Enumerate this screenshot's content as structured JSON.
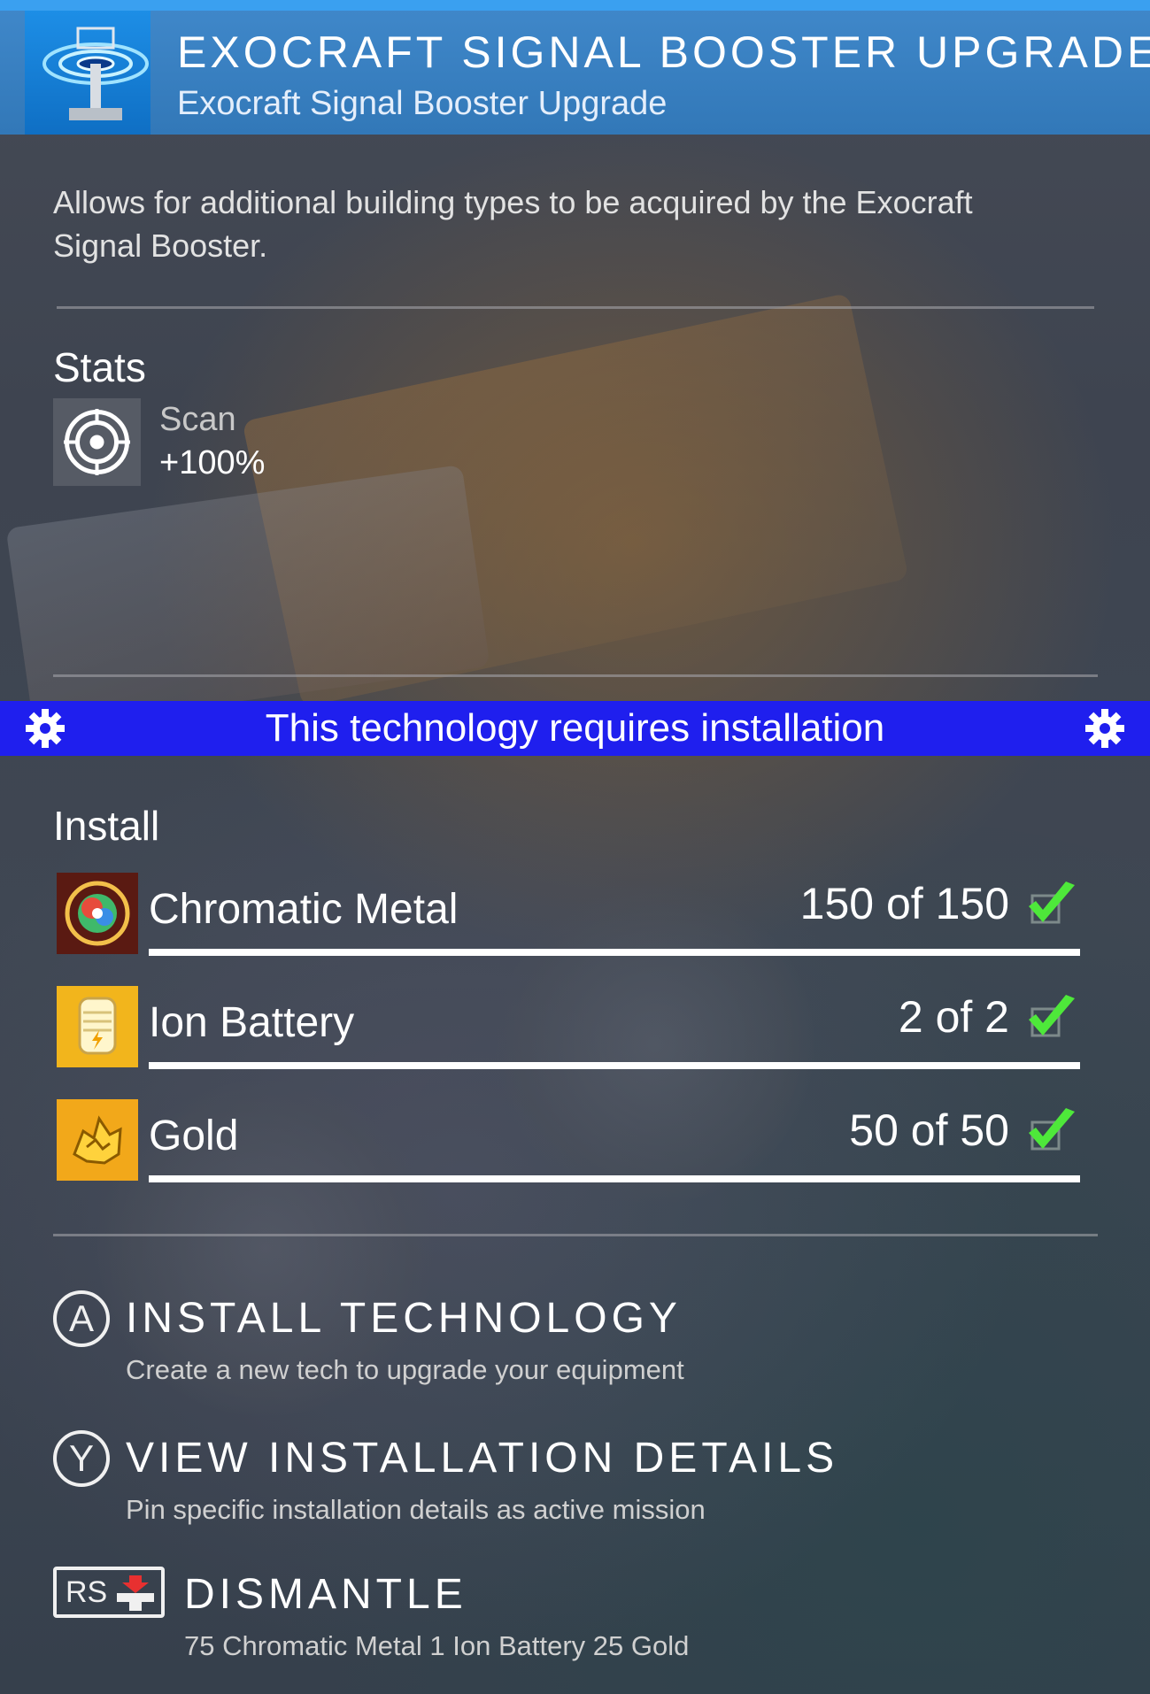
{
  "header": {
    "title": "EXOCRAFT SIGNAL BOOSTER UPGRADE TA",
    "subtitle": "Exocraft Signal Booster Upgrade",
    "icon": "signal-booster-icon"
  },
  "description": "Allows for additional building types to be acquired by the Exocraft Signal Booster.",
  "stats": {
    "label": "Stats",
    "items": [
      {
        "icon": "target-icon",
        "name": "Scan",
        "value": "+100%"
      }
    ]
  },
  "banner": {
    "text": "This technology requires installation",
    "icon": "gear-icon",
    "color": "#1f1fee"
  },
  "install": {
    "label": "Install",
    "requirements": [
      {
        "icon": "chromatic-metal-icon",
        "name": "Chromatic Metal",
        "count": "150 of 150",
        "have": 150,
        "need": 150,
        "fulfilled": true
      },
      {
        "icon": "ion-battery-icon",
        "name": "Ion Battery",
        "count": "2 of 2",
        "have": 2,
        "need": 2,
        "fulfilled": true
      },
      {
        "icon": "gold-icon",
        "name": "Gold",
        "count": "50 of 50",
        "have": 50,
        "need": 50,
        "fulfilled": true
      }
    ]
  },
  "actions": {
    "install": {
      "button": "A",
      "title": "INSTALL TECHNOLOGY",
      "description": "Create a new tech to upgrade your equipment"
    },
    "details": {
      "button": "Y",
      "title": "VIEW INSTALLATION DETAILS",
      "description": "Pin specific installation details as active mission"
    },
    "dismantle": {
      "button": "RS",
      "title": "DISMANTLE",
      "description": "75 Chromatic Metal 1 Ion Battery 25 Gold"
    }
  },
  "colors": {
    "header": "#3278b8",
    "accent": "#3aa0f0",
    "check": "#4ee83a"
  }
}
